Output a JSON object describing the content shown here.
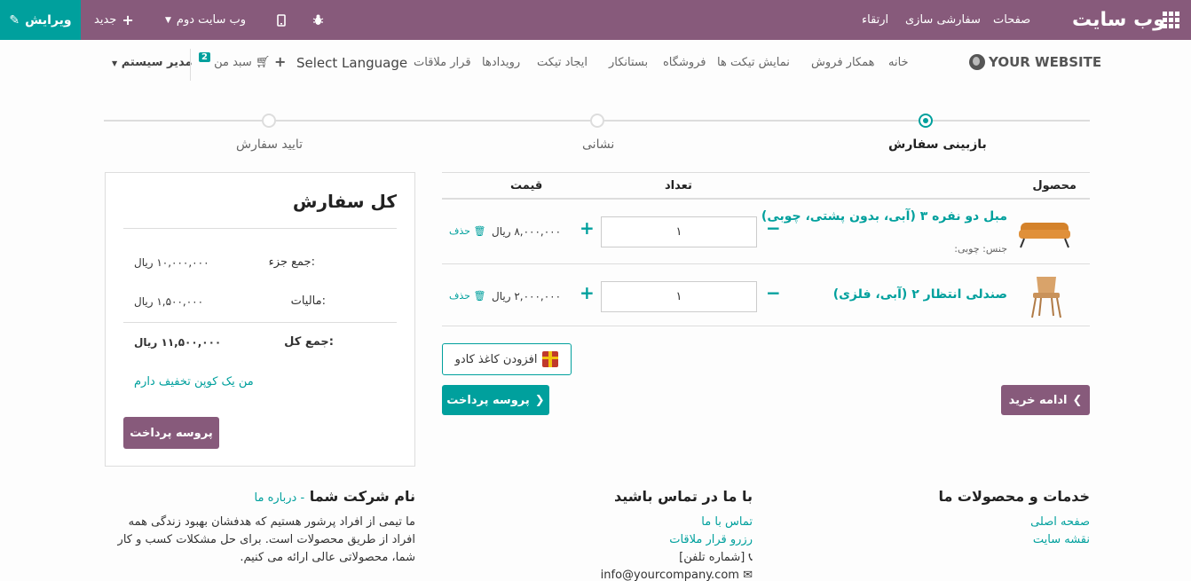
{
  "topbar": {
    "brand": "وب سایت",
    "menu": [
      "صفحات",
      "سفارشی سازی",
      "ارتقاء"
    ],
    "bug_icon": "bug-icon",
    "mobile_icon": "mobile-icon",
    "site_switcher": "وب سایت دوم",
    "new_label": "جدید",
    "edit_label": "ویرایش"
  },
  "nav": {
    "logo_text": "YOUR WEBSITE",
    "links": [
      "خانه",
      "همکار فروش",
      "نمایش تیکت ها",
      "فروشگاه",
      "بستانکار",
      "ایجاد تیکت",
      "رویدادها",
      "قرار ملاقات"
    ],
    "language": "Select Language",
    "cart_label": "سبد من",
    "cart_count": "2",
    "user": "مدیر سیستم"
  },
  "steps": [
    {
      "label": "بازبینی سفارش",
      "active": true
    },
    {
      "label": "نشانی",
      "active": false
    },
    {
      "label": "تایید سفارش",
      "active": false
    }
  ],
  "cart": {
    "headers": {
      "product": "محصول",
      "qty": "تعداد",
      "price": "قیمت"
    },
    "items": [
      {
        "name": "مبل دو نفره ۳ (آبی، بدون پشتی، چوبی)",
        "attr": "جنس: چوبی:",
        "qty": "۱",
        "price": "۸,۰۰۰,۰۰۰ ریال",
        "remove": "حذف"
      },
      {
        "name": "صندلی انتظار ۲ (آبی، فلزی)",
        "attr": "",
        "qty": "۱",
        "price": "۲,۰۰۰,۰۰۰ ریال",
        "remove": "حذف"
      }
    ],
    "gift_label": "افزودن کاغذ کادو",
    "checkout_label": "پروسه پرداخت",
    "continue_label": "ادامه خرید"
  },
  "summary": {
    "title": "کل سفارش",
    "subtotal_label": "جمع جزء:",
    "subtotal": "۱۰,۰۰۰,۰۰۰ ریال",
    "tax_label": "مالیات:",
    "tax": "۱,۵۰۰,۰۰۰ ریال",
    "total_label": "جمع کل:",
    "total": "۱۱,۵۰۰,۰۰۰ ریال",
    "coupon": "من یک کوپن تخفیف دارم",
    "checkout": "پروسه پرداخت"
  },
  "footer": {
    "services_title": "خدمات و محصولات ما",
    "services_links": [
      "صفحه اصلی",
      "نقشه سایت"
    ],
    "contact_title": "با ما در تماس باشید",
    "contact_links": [
      "تماس با ما",
      "رزرو قرار ملاقات"
    ],
    "phone": "[شماره تلفن]",
    "email": "info@yourcompany.com",
    "company_title": "نام شرکت شما",
    "about_link": "درباره ما",
    "about_text": "ما تیمی از افراد پرشور هستیم که هدفشان بهبود زندگی همه افراد از طریق محصولات است. برای حل مشکلات کسب و کار شما، محصولاتی عالی ارائه می کنیم."
  }
}
